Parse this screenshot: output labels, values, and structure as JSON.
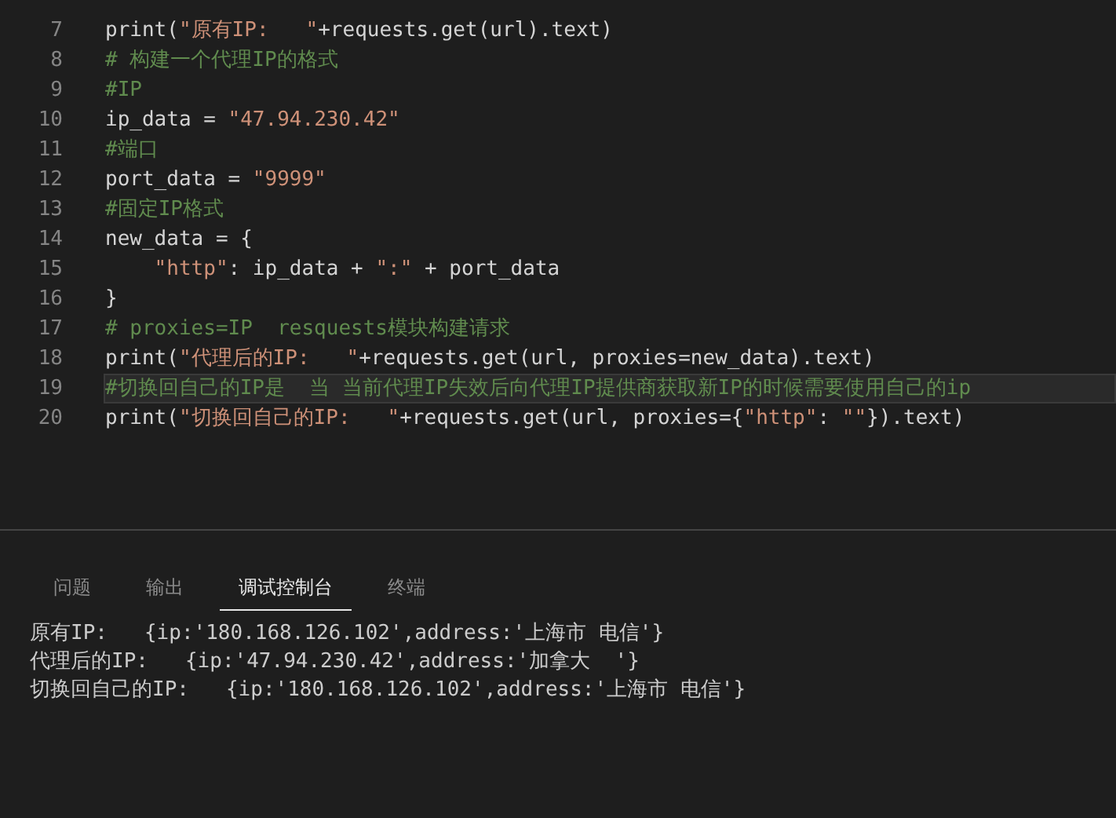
{
  "editor": {
    "lines": [
      {
        "number": "7",
        "current": false,
        "tokens": [
          {
            "kind": "plain",
            "text": "print("
          },
          {
            "kind": "string",
            "text": "\"原有IP:   \""
          },
          {
            "kind": "plain",
            "text": "+requests.get(url).text)"
          }
        ]
      },
      {
        "number": "8",
        "current": false,
        "tokens": [
          {
            "kind": "comment",
            "text": "# 构建一个代理IP的格式"
          }
        ]
      },
      {
        "number": "9",
        "current": false,
        "tokens": [
          {
            "kind": "comment",
            "text": "#IP"
          }
        ]
      },
      {
        "number": "10",
        "current": false,
        "tokens": [
          {
            "kind": "plain",
            "text": "ip_data = "
          },
          {
            "kind": "string",
            "text": "\"47.94.230.42\""
          }
        ]
      },
      {
        "number": "11",
        "current": false,
        "tokens": [
          {
            "kind": "comment",
            "text": "#端口"
          }
        ]
      },
      {
        "number": "12",
        "current": false,
        "tokens": [
          {
            "kind": "plain",
            "text": "port_data = "
          },
          {
            "kind": "string",
            "text": "\"9999\""
          }
        ]
      },
      {
        "number": "13",
        "current": false,
        "tokens": [
          {
            "kind": "comment",
            "text": "#固定IP格式"
          }
        ]
      },
      {
        "number": "14",
        "current": false,
        "tokens": [
          {
            "kind": "plain",
            "text": "new_data = {"
          }
        ]
      },
      {
        "number": "15",
        "current": false,
        "tokens": [
          {
            "kind": "string",
            "text": "    \"http\""
          },
          {
            "kind": "plain",
            "text": ": ip_data + "
          },
          {
            "kind": "string",
            "text": "\":\""
          },
          {
            "kind": "plain",
            "text": " + port_data"
          }
        ]
      },
      {
        "number": "16",
        "current": false,
        "tokens": [
          {
            "kind": "plain",
            "text": "}"
          }
        ]
      },
      {
        "number": "17",
        "current": false,
        "tokens": [
          {
            "kind": "comment",
            "text": "# proxies=IP  resquests模块构建请求"
          }
        ]
      },
      {
        "number": "18",
        "current": false,
        "tokens": [
          {
            "kind": "plain",
            "text": "print("
          },
          {
            "kind": "string",
            "text": "\"代理后的IP:   \""
          },
          {
            "kind": "plain",
            "text": "+requests.get(url, proxies=new_data).text)"
          }
        ]
      },
      {
        "number": "19",
        "current": true,
        "tokens": [
          {
            "kind": "comment",
            "text": "#切换回自己的IP是  当 当前代理IP失效后向代理IP提供商获取新IP的时候需要使用自己的ip"
          }
        ]
      },
      {
        "number": "20",
        "current": false,
        "tokens": [
          {
            "kind": "plain",
            "text": "print("
          },
          {
            "kind": "string",
            "text": "\"切换回自己的IP:   \""
          },
          {
            "kind": "plain",
            "text": "+requests.get(url, proxies={"
          },
          {
            "kind": "string",
            "text": "\"http\""
          },
          {
            "kind": "plain",
            "text": ": "
          },
          {
            "kind": "string",
            "text": "\"\""
          },
          {
            "kind": "plain",
            "text": "}).text)"
          }
        ]
      }
    ]
  },
  "panel": {
    "tabs": [
      {
        "label": "问题",
        "selected": false
      },
      {
        "label": "输出",
        "selected": false
      },
      {
        "label": "调试控制台",
        "selected": true
      },
      {
        "label": "终端",
        "selected": false
      }
    ],
    "output": [
      "原有IP:   {ip:'180.168.126.102',address:'上海市 电信'}",
      "代理后的IP:   {ip:'47.94.230.42',address:'加拿大  '}",
      "切换回自己的IP:   {ip:'180.168.126.102',address:'上海市 电信'}"
    ]
  }
}
